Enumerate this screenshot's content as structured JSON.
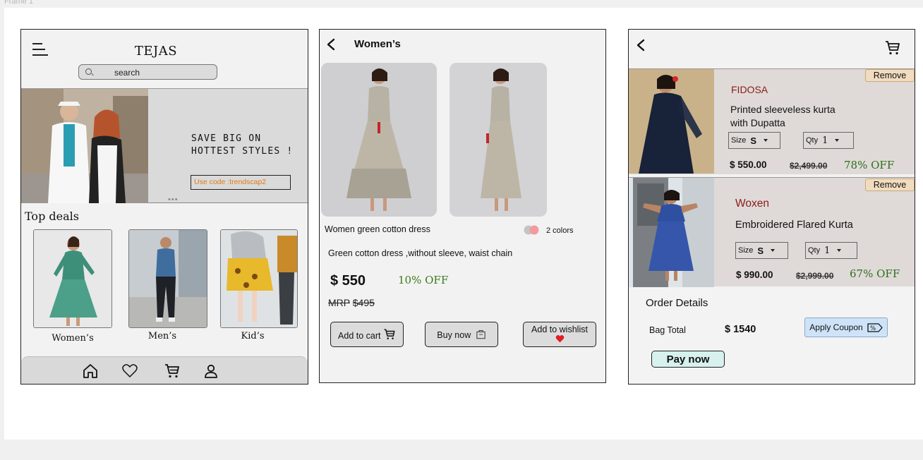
{
  "frame_label": "Frame 1",
  "home": {
    "brand": "TEJAS",
    "search_placeholder": "search",
    "banner": {
      "line1": "SAVE  BIG  ON",
      "line2": "HOTTEST STYLES !",
      "coupon": "Use code :trendscap2",
      "carousel_dots": "•••"
    },
    "top_deals_title": "Top deals",
    "categories": [
      "Women’s",
      "Men’s",
      "Kid’s"
    ],
    "nav": [
      "home-icon",
      "heart-icon",
      "cart-icon",
      "user-icon"
    ]
  },
  "product": {
    "title": "Women’s",
    "name": "Women green cotton dress",
    "colors": "2 colors",
    "description": "Green cotton dress ,without sleeve, waist chain",
    "price": "$ 550",
    "off": "10% OFF",
    "mrp_label": "MRP",
    "mrp_value": "$495",
    "buttons": {
      "add_to_cart": "Add to cart",
      "buy_now": "Buy now",
      "add_to_wishlist": "Add to wishlist"
    }
  },
  "cart": {
    "items": [
      {
        "remove": "Remove",
        "brand": "FIDOSA",
        "title_line1": "Printed sleeveless kurta",
        "title_line2": "with Dupatta",
        "size_label": "Size",
        "size": "S",
        "qty_label": "Qty",
        "qty": "1",
        "price": "$ 550.00",
        "original": "$2,499.00",
        "off": "78% OFF"
      },
      {
        "remove": "Remove",
        "brand": "Woxen",
        "title_line1": "Embroidered Flared Kurta",
        "title_line2": "",
        "size_label": "Size",
        "size": "S",
        "qty_label": "Qty",
        "qty": "1",
        "price": "$ 990.00",
        "original": "$2,999.00",
        "off": "67% OFF"
      }
    ],
    "order_title": "Order Details",
    "bag_total_label": "Bag Total",
    "bag_total_value": "$ 1540",
    "apply_coupon": "Apply Coupon",
    "pay_now": "Pay now"
  },
  "colors": {
    "accent_orange": "#e07a15",
    "brand_red": "#8b1a1a",
    "discount_green": "#2f6e1a",
    "coupon_blue": "#cfe3f8",
    "pay_teal": "#d6f1ee",
    "remove_peach": "#f2dcc0"
  }
}
